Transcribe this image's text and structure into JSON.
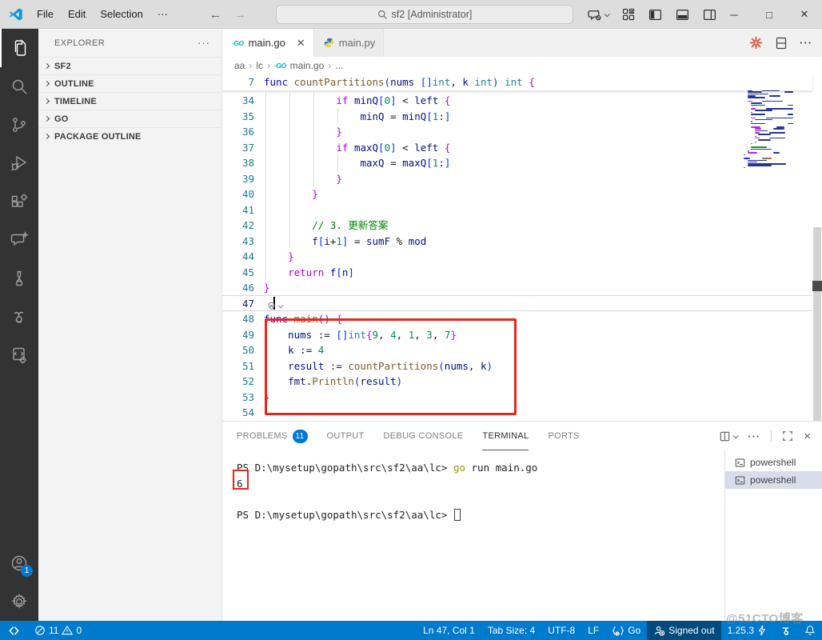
{
  "window": {
    "menus": [
      "File",
      "Edit",
      "Selection",
      "···"
    ],
    "search_value": "sf2 [Administrator]",
    "controls": {
      "minimize": "─",
      "maximize": "□",
      "close": "✕"
    }
  },
  "activity_bar": {
    "items": [
      "explorer",
      "search",
      "source-control",
      "run-debug",
      "extensions",
      "chat",
      "testing",
      "go",
      "task-config"
    ],
    "active_item": "explorer",
    "account_badge": "1"
  },
  "sidebar": {
    "title": "EXPLORER",
    "more_label": "···",
    "sections": [
      "SF2",
      "OUTLINE",
      "TIMELINE",
      "GO",
      "PACKAGE OUTLINE"
    ]
  },
  "editor_tabs": [
    {
      "label": "main.go",
      "icon": "go",
      "active": true,
      "close": "✕"
    },
    {
      "label": "main.py",
      "icon": "python",
      "active": false
    }
  ],
  "breadcrumb": [
    "aa",
    "lc",
    "main.go",
    "..."
  ],
  "editor": {
    "sticky_line": {
      "num": "7",
      "tok": [
        [
          "k",
          "func "
        ],
        [
          "f",
          "countPartitions"
        ],
        [
          "b",
          "("
        ],
        [
          "v",
          "nums "
        ],
        [
          "b",
          "[]"
        ],
        [
          "t",
          "int"
        ],
        [
          "o",
          ", "
        ],
        [
          "v",
          "k "
        ],
        [
          "t",
          "int"
        ],
        [
          "b",
          ")"
        ],
        [
          "o",
          " "
        ],
        [
          "t",
          "int"
        ],
        [
          "o",
          " "
        ],
        [
          "p",
          "{"
        ]
      ]
    },
    "lines": [
      {
        "num": "34",
        "ind": 3,
        "g": 3,
        "tok": [
          [
            "c",
            "if "
          ],
          [
            "v",
            "minQ"
          ],
          [
            "b",
            "["
          ],
          [
            "n",
            "0"
          ],
          [
            "b",
            "]"
          ],
          [
            "o",
            " < "
          ],
          [
            "v",
            "left"
          ],
          [
            "o",
            " "
          ],
          [
            "p",
            "{"
          ]
        ]
      },
      {
        "num": "35",
        "ind": 4,
        "g": 4,
        "tok": [
          [
            "v",
            "minQ"
          ],
          [
            "o",
            " = "
          ],
          [
            "v",
            "minQ"
          ],
          [
            "b",
            "["
          ],
          [
            "n",
            "1"
          ],
          [
            "o",
            ":"
          ],
          [
            "b",
            "]"
          ]
        ]
      },
      {
        "num": "36",
        "ind": 3,
        "g": 3,
        "tok": [
          [
            "p",
            "}"
          ]
        ]
      },
      {
        "num": "37",
        "ind": 3,
        "g": 3,
        "tok": [
          [
            "c",
            "if "
          ],
          [
            "v",
            "maxQ"
          ],
          [
            "b",
            "["
          ],
          [
            "n",
            "0"
          ],
          [
            "b",
            "]"
          ],
          [
            "o",
            " < "
          ],
          [
            "v",
            "left"
          ],
          [
            "o",
            " "
          ],
          [
            "p",
            "{"
          ]
        ]
      },
      {
        "num": "38",
        "ind": 4,
        "g": 4,
        "tok": [
          [
            "v",
            "maxQ"
          ],
          [
            "o",
            " = "
          ],
          [
            "v",
            "maxQ"
          ],
          [
            "b",
            "["
          ],
          [
            "n",
            "1"
          ],
          [
            "o",
            ":"
          ],
          [
            "b",
            "]"
          ]
        ]
      },
      {
        "num": "39",
        "ind": 3,
        "g": 3,
        "tok": [
          [
            "p",
            "}"
          ]
        ]
      },
      {
        "num": "40",
        "ind": 2,
        "g": 2,
        "tok": [
          [
            "p",
            "}"
          ]
        ]
      },
      {
        "num": "41",
        "ind": 0,
        "g": 2,
        "tok": []
      },
      {
        "num": "42",
        "ind": 2,
        "g": 2,
        "tok": [
          [
            "m",
            "// 3. 更新答案"
          ]
        ]
      },
      {
        "num": "43",
        "ind": 2,
        "g": 2,
        "tok": [
          [
            "v",
            "f"
          ],
          [
            "b",
            "["
          ],
          [
            "v",
            "i"
          ],
          [
            "o",
            "+"
          ],
          [
            "n",
            "1"
          ],
          [
            "b",
            "]"
          ],
          [
            "o",
            " = "
          ],
          [
            "v",
            "sumF"
          ],
          [
            "o",
            " % "
          ],
          [
            "v",
            "mod"
          ]
        ]
      },
      {
        "num": "44",
        "ind": 1,
        "g": 1,
        "tok": [
          [
            "p",
            "}"
          ]
        ]
      },
      {
        "num": "45",
        "ind": 1,
        "g": 1,
        "tok": [
          [
            "c",
            "return "
          ],
          [
            "v",
            "f"
          ],
          [
            "b",
            "["
          ],
          [
            "v",
            "n"
          ],
          [
            "b",
            "]"
          ]
        ]
      },
      {
        "num": "46",
        "ind": 0,
        "g": 0,
        "tok": [
          [
            "p",
            "}"
          ]
        ]
      },
      {
        "num": "47",
        "ind": 0,
        "g": 0,
        "tok": [],
        "cursor": true
      },
      {
        "num": "48",
        "ind": 0,
        "g": 0,
        "tok": [
          [
            "k",
            "func "
          ],
          [
            "f",
            "main"
          ],
          [
            "b",
            "()"
          ],
          [
            "o",
            " "
          ],
          [
            "p",
            "{"
          ]
        ]
      },
      {
        "num": "49",
        "ind": 1,
        "g": 1,
        "tok": [
          [
            "v",
            "nums"
          ],
          [
            "o",
            " := "
          ],
          [
            "b",
            "[]"
          ],
          [
            "t",
            "int"
          ],
          [
            "p",
            "{"
          ],
          [
            "n",
            "9"
          ],
          [
            "o",
            ", "
          ],
          [
            "n",
            "4"
          ],
          [
            "o",
            ", "
          ],
          [
            "n",
            "1"
          ],
          [
            "o",
            ", "
          ],
          [
            "n",
            "3"
          ],
          [
            "o",
            ", "
          ],
          [
            "n",
            "7"
          ],
          [
            "p",
            "}"
          ]
        ]
      },
      {
        "num": "50",
        "ind": 1,
        "g": 1,
        "tok": [
          [
            "v",
            "k"
          ],
          [
            "o",
            " := "
          ],
          [
            "n",
            "4"
          ]
        ]
      },
      {
        "num": "51",
        "ind": 1,
        "g": 1,
        "tok": [
          [
            "v",
            "result"
          ],
          [
            "o",
            " := "
          ],
          [
            "f",
            "countPartitions"
          ],
          [
            "b",
            "("
          ],
          [
            "v",
            "nums"
          ],
          [
            "o",
            ", "
          ],
          [
            "v",
            "k"
          ],
          [
            "b",
            ")"
          ]
        ]
      },
      {
        "num": "52",
        "ind": 1,
        "g": 1,
        "tok": [
          [
            "v",
            "fmt"
          ],
          [
            "o",
            "."
          ],
          [
            "f",
            "Println"
          ],
          [
            "b",
            "("
          ],
          [
            "v",
            "result"
          ],
          [
            "b",
            ")"
          ]
        ]
      },
      {
        "num": "53",
        "ind": 0,
        "g": 0,
        "tok": [
          [
            "p",
            "}"
          ]
        ]
      },
      {
        "num": "54",
        "ind": 0,
        "g": 0,
        "tok": []
      }
    ],
    "minimap_rows": [
      [
        [
          0,
          7,
          "k"
        ],
        [
          8,
          4,
          "v"
        ]
      ],
      [],
      [
        [
          0,
          6,
          "c"
        ],
        [
          7,
          1,
          "o"
        ]
      ],
      [
        [
          2,
          5,
          "s"
        ]
      ],
      [
        [
          0,
          1,
          "o"
        ]
      ],
      [],
      [
        [
          0,
          4,
          "k"
        ],
        [
          5,
          16,
          "f"
        ],
        [
          22,
          16,
          "v"
        ],
        [
          39,
          4,
          "t"
        ]
      ],
      [
        [
          1,
          3,
          "k"
        ],
        [
          5,
          11,
          "v"
        ]
      ],
      [
        [
          1,
          9,
          "v"
        ],
        [
          11,
          6,
          "v"
        ]
      ],
      [
        [
          1,
          13,
          "v"
        ]
      ],
      [
        [
          1,
          5,
          "v"
        ],
        [
          7,
          7,
          "v"
        ]
      ],
      [
        [
          1,
          11,
          "v"
        ]
      ],
      [],
      [
        [
          1,
          3,
          "c"
        ],
        [
          5,
          13,
          "v"
        ],
        [
          19,
          3,
          "v"
        ]
      ],
      [
        [
          2,
          7,
          "v"
        ]
      ],
      [
        [
          2,
          9,
          "v"
        ],
        [
          12,
          4,
          "v"
        ]
      ],
      [],
      [
        [
          2,
          3,
          "c"
        ],
        [
          6,
          24,
          "v"
        ],
        [
          31,
          5,
          "v"
        ]
      ],
      [
        [
          3,
          11,
          "v"
        ]
      ],
      [
        [
          2,
          1,
          "o"
        ]
      ],
      [
        [
          2,
          9,
          "v"
        ],
        [
          12,
          5,
          "v"
        ]
      ],
      [],
      [
        [
          2,
          3,
          "c"
        ],
        [
          6,
          24,
          "v"
        ],
        [
          31,
          5,
          "v"
        ]
      ],
      [
        [
          3,
          11,
          "v"
        ]
      ],
      [
        [
          2,
          1,
          "o"
        ]
      ],
      [
        [
          2,
          9,
          "v"
        ],
        [
          12,
          5,
          "v"
        ]
      ],
      [],
      [
        [
          2,
          6,
          "c"
        ],
        [
          9,
          5,
          "v"
        ]
      ],
      [
        [
          3,
          4,
          "c"
        ],
        [
          8,
          7,
          "v"
        ]
      ],
      [
        [
          3,
          8,
          "v"
        ]
      ],
      [
        [
          3,
          3,
          "c"
        ],
        [
          7,
          10,
          "v"
        ]
      ],
      [
        [
          4,
          8,
          "v"
        ]
      ],
      [
        [
          3,
          1,
          "o"
        ]
      ],
      [
        [
          3,
          3,
          "c"
        ],
        [
          7,
          10,
          "v"
        ]
      ],
      [
        [
          4,
          8,
          "v"
        ]
      ],
      [
        [
          3,
          1,
          "o"
        ]
      ],
      [
        [
          2,
          1,
          "o"
        ]
      ],
      [],
      [
        [
          2,
          10,
          "m"
        ]
      ],
      [
        [
          2,
          13,
          "v"
        ]
      ],
      [
        [
          1,
          1,
          "o"
        ]
      ],
      [
        [
          1,
          6,
          "c"
        ],
        [
          8,
          4,
          "v"
        ]
      ],
      [
        [
          0,
          1,
          "o"
        ]
      ],
      [],
      [
        [
          0,
          4,
          "k"
        ],
        [
          5,
          6,
          "f"
        ]
      ],
      [
        [
          1,
          12,
          "v"
        ],
        [
          14,
          11,
          "n"
        ]
      ],
      [
        [
          1,
          6,
          "v"
        ]
      ],
      [
        [
          1,
          24,
          "v"
        ]
      ],
      [
        [
          1,
          15,
          "v"
        ]
      ],
      [
        [
          0,
          1,
          "o"
        ]
      ]
    ]
  },
  "panel": {
    "tabs": [
      {
        "label": "PROBLEMS",
        "badge": "11"
      },
      {
        "label": "OUTPUT"
      },
      {
        "label": "DEBUG CONSOLE"
      },
      {
        "label": "TERMINAL",
        "active": true
      },
      {
        "label": "PORTS"
      }
    ],
    "terminal": {
      "lines": [
        {
          "tok": [
            [
              "x",
              "PS D:\\mysetup\\gopath\\src\\sf2\\aa\\lc> "
            ],
            [
              "cmd",
              "go"
            ],
            [
              "x",
              " run main.go"
            ]
          ]
        },
        {
          "tok": [
            [
              "x",
              "6"
            ]
          ]
        },
        {
          "tok": []
        },
        {
          "tok": [
            [
              "x",
              "PS D:\\mysetup\\gopath\\src\\sf2\\aa\\lc> "
            ]
          ],
          "cursor": true
        }
      ],
      "list": [
        {
          "label": "powershell",
          "selected": false
        },
        {
          "label": "powershell",
          "selected": true
        }
      ]
    }
  },
  "status_bar": {
    "problems": {
      "errors": "11",
      "warnings": "0"
    },
    "right_items": [
      {
        "id": "cursor-position",
        "label": "Ln 47, Col 1"
      },
      {
        "id": "tab-size",
        "label": "Tab Size: 4"
      },
      {
        "id": "encoding",
        "label": "UTF-8"
      },
      {
        "id": "eol",
        "label": "LF"
      },
      {
        "id": "language-go",
        "label": "Go",
        "icon": "braces"
      },
      {
        "id": "signed-out",
        "label": "Signed out",
        "icon": "account",
        "dark": true
      },
      {
        "id": "go-version",
        "label": "1.25.3",
        "icon_after": "bolt"
      },
      {
        "id": "go-tools",
        "label": "",
        "icon": "gopher"
      },
      {
        "id": "notifications",
        "label": "",
        "icon": "bell"
      }
    ]
  },
  "watermark": "@51CTO博客",
  "colors": {
    "accent": "#007acc",
    "annotation": "#e8261d",
    "activity_bar": "#333333",
    "titlebar": "#dddddd"
  }
}
